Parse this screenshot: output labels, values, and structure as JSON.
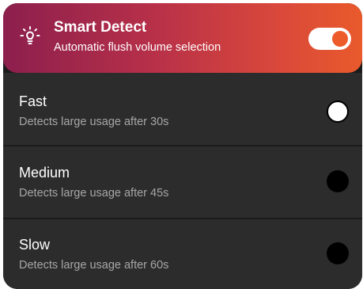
{
  "header": {
    "icon": "lightbulb-icon",
    "title": "Smart Detect",
    "subtitle": "Automatic flush volume selection",
    "toggle_on": true
  },
  "options": [
    {
      "label": "Fast",
      "description": "Detects large usage after 30s",
      "selected": true
    },
    {
      "label": "Medium",
      "description": "Detects large usage after 45s",
      "selected": false
    },
    {
      "label": "Slow",
      "description": "Detects large usage after 60s",
      "selected": false
    }
  ],
  "colors": {
    "gradient_start": "#8c1f4d",
    "gradient_end": "#e95a2c",
    "toggle_knob": "#ee5b2a",
    "row_background": "#2c2c2c",
    "divider": "#1b1b1b"
  }
}
